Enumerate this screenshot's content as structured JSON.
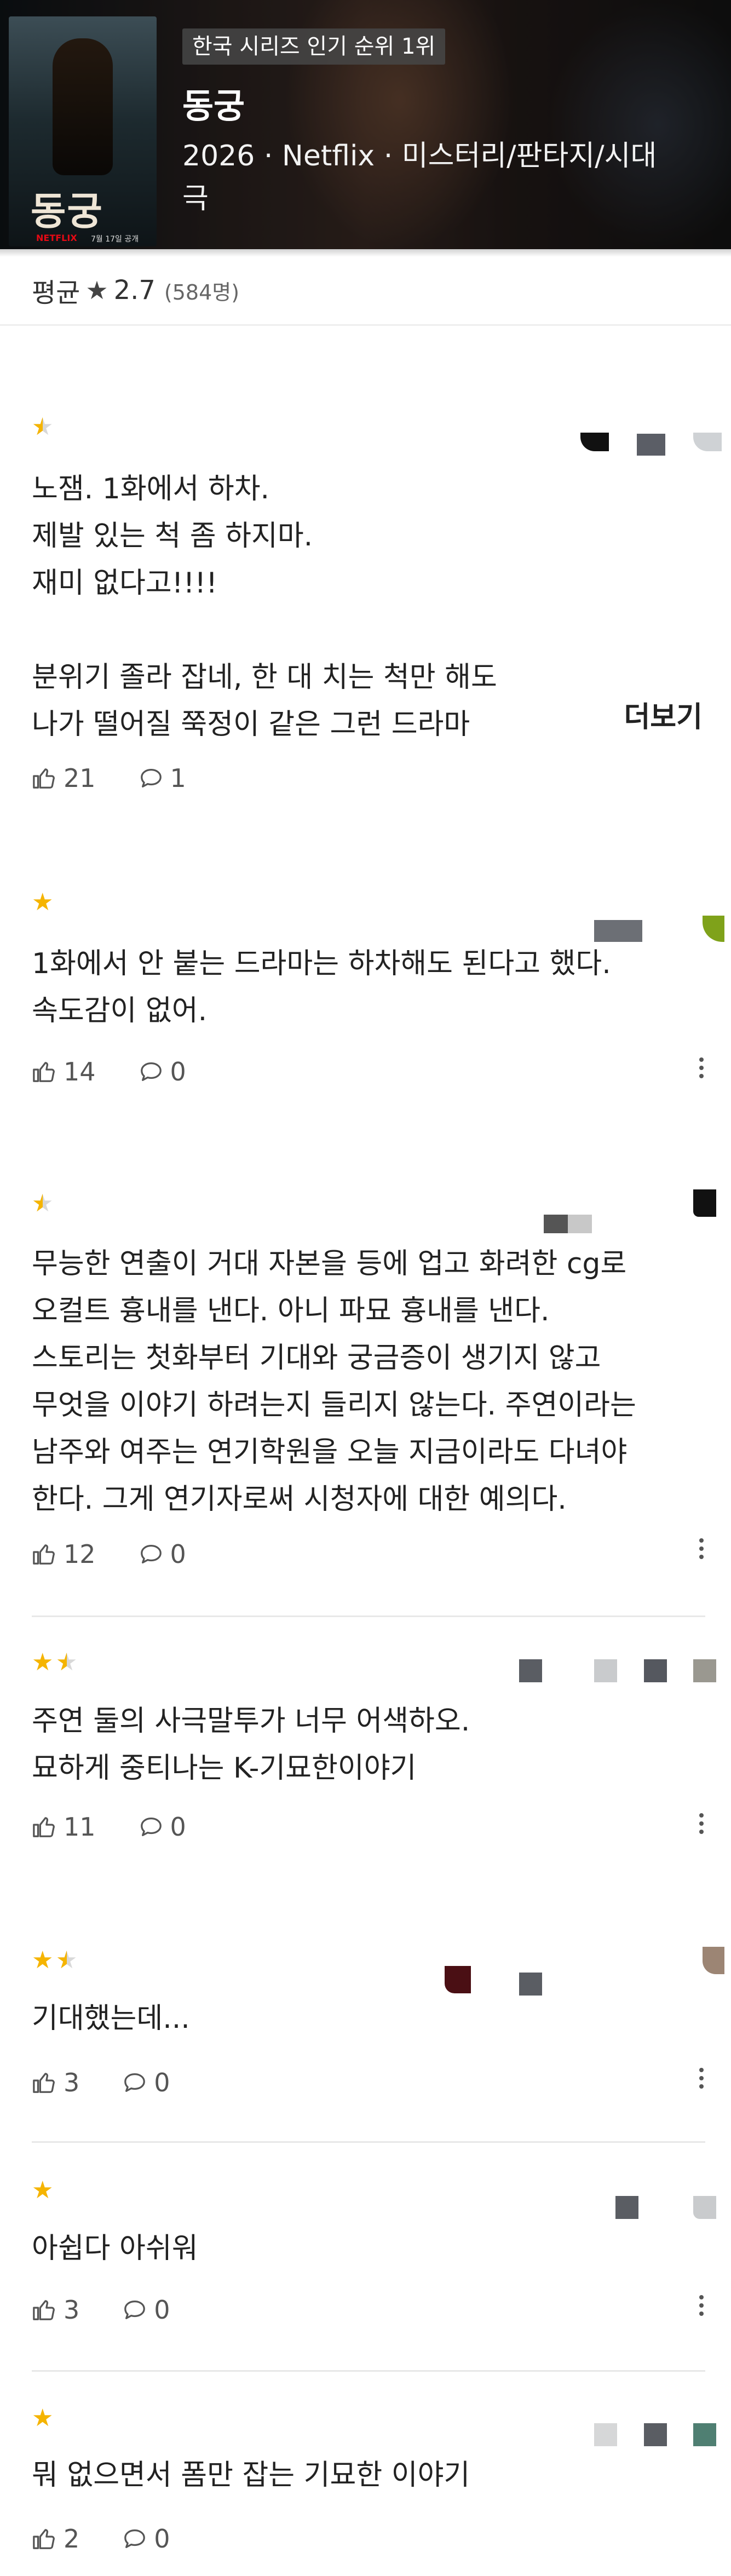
{
  "header": {
    "rank_badge": "한국 시리즈 인기 순위 1위",
    "title": "동궁",
    "meta": "2026 · Netflix · 미스터리/판타지/시대극",
    "poster_title": "동궁",
    "poster_logo": "NETFLIX",
    "poster_date": "7월 17일 공개"
  },
  "average": {
    "label": "평균",
    "star_icon": "star-icon",
    "value": "2.7",
    "count": "(584명)"
  },
  "reviews": [
    {
      "rating": 0.5,
      "text": "노잼. 1화에서 하차.\n제발 있는 척 좀 하지마.\n재미 없다고!!!!\n\n분위기 졸라 잡네, 한 대 치는 척만 해도\n나가 떨어질 쭉정이 같은 그런 드라마",
      "more": "더보기",
      "likes": "21",
      "comments": "1"
    },
    {
      "rating": 1,
      "text": "1화에서 안 붙는 드라마는 하차해도 된다고 했다.\n속도감이 없어.",
      "likes": "14",
      "comments": "0"
    },
    {
      "rating": 0.5,
      "text": "무능한 연출이 거대 자본을 등에 업고 화려한 cg로\n오컬트 흉내를 낸다. 아니 파묘 흉내를 낸다.\n스토리는 첫화부터 기대와 궁금증이 생기지 않고\n무엇을 이야기 하려는지 들리지 않는다. 주연이라는\n남주와 여주는 연기학원을 오늘 지금이라도 다녀야\n한다. 그게 연기자로써 시청자에 대한 예의다.",
      "likes": "12",
      "comments": "0"
    },
    {
      "rating": 1.5,
      "text": "주연 둘의 사극말투가 너무 어색하오.\n묘하게 중티나는 K-기묘한이야기",
      "likes": "11",
      "comments": "0"
    },
    {
      "rating": 1.5,
      "text": "기대했는데...",
      "likes": "3",
      "comments": "0"
    },
    {
      "rating": 1,
      "text": "아쉽다 아쉬워",
      "likes": "3",
      "comments": "0"
    },
    {
      "rating": 1,
      "text": "뭐 없으면서 폼만 잡는 기묘한 이야기",
      "likes": "2",
      "comments": "0"
    }
  ],
  "colors": {
    "star": "#f5b400",
    "text": "#222222",
    "muted": "#555555",
    "divider": "#e8e8e8"
  }
}
